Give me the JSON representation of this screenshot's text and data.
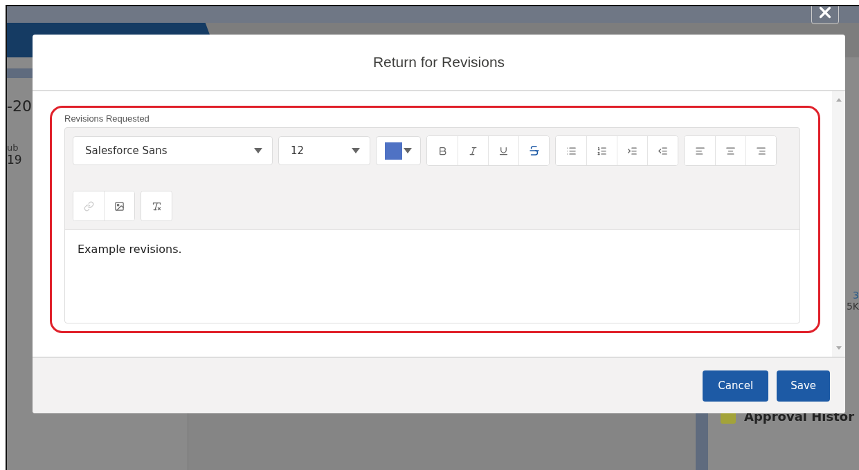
{
  "background": {
    "left_fragments": [
      "-20",
      "ub",
      "19"
    ],
    "right_fragments": [
      "3",
      "5K"
    ],
    "card_title": "Approval Histor"
  },
  "modal": {
    "title": "Return for Revisions",
    "field": {
      "label": "Revisions Requested",
      "toolbar": {
        "font": "Salesforce Sans",
        "size": "12",
        "color": "#4f72c4",
        "rows": [
          [
            [
              {
                "kind": "bold",
                "disabled": false
              },
              {
                "kind": "italic",
                "disabled": false
              },
              {
                "kind": "underline",
                "disabled": false
              },
              {
                "kind": "strike",
                "disabled": false
              }
            ],
            [
              {
                "kind": "bullets",
                "disabled": false
              },
              {
                "kind": "numbers",
                "disabled": false
              },
              {
                "kind": "indent",
                "disabled": false
              },
              {
                "kind": "outdent",
                "disabled": false
              }
            ],
            [
              {
                "kind": "left",
                "disabled": false
              },
              {
                "kind": "center",
                "disabled": false
              },
              {
                "kind": "right",
                "disabled": false
              }
            ]
          ],
          [
            [
              {
                "kind": "link",
                "disabled": true
              },
              {
                "kind": "image",
                "disabled": false
              }
            ],
            [
              {
                "kind": "clear",
                "disabled": false
              }
            ]
          ]
        ]
      },
      "value": "Example revisions."
    },
    "buttons": [
      "Cancel",
      "Save"
    ]
  }
}
